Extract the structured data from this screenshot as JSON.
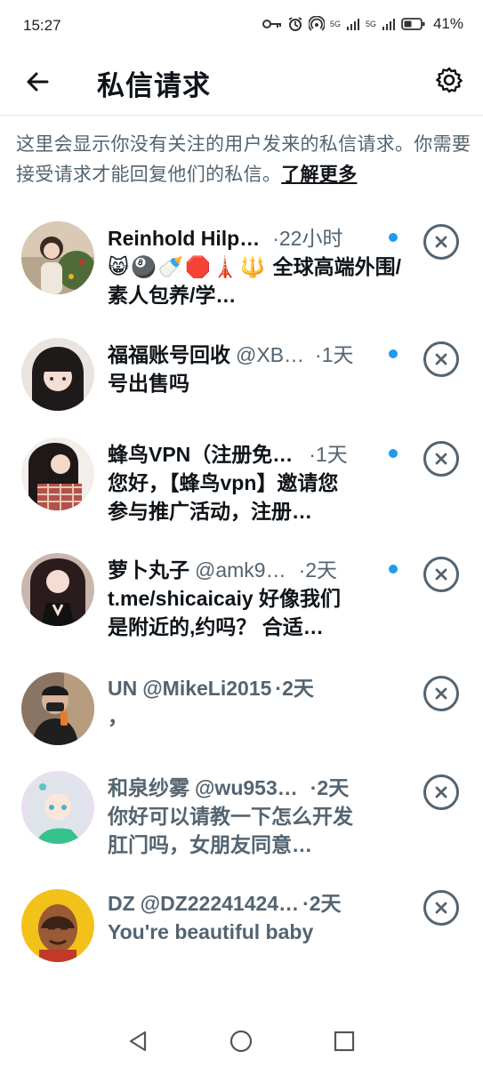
{
  "status_bar": {
    "time": "15:27",
    "net1": "1",
    "net1_type": "5G",
    "net2_type": "5G",
    "battery": "41%"
  },
  "header": {
    "title": "私信请求",
    "back_icon": "arrow-left-icon",
    "settings_icon": "gear-icon"
  },
  "notice": {
    "text": "这里会显示你没有关注的用户发来的私信请求。你需要接受请求才能回复他们的私信。",
    "learn_more": "了解更多"
  },
  "requests": [
    {
      "name": "Reinhold Hilp…",
      "handle": "",
      "sep": "·",
      "time": "22小时",
      "emoji": "😸🎱🍼🛑🗼🔱",
      "message": "全球高端外围/素人包养/学…",
      "unread": true
    },
    {
      "name": "福福账号回收",
      "handle": "@XB…",
      "sep": "·",
      "time": "1天",
      "message": "号出售吗",
      "unread": true
    },
    {
      "name": "蜂鸟VPN（注册免…",
      "handle": "",
      "sep": "·",
      "time": "1天",
      "message": "您好，【蜂鸟vpn】邀请您参与推广活动，注册…",
      "unread": true
    },
    {
      "name": "萝卜丸子",
      "handle": "@amk9…",
      "sep": "·",
      "time": "2天",
      "message": "t.me/shicaicaiy 好像我们是附近的,约吗？ 合适…",
      "unread": true
    },
    {
      "name": "UN",
      "handle": "@MikeLi2015",
      "sep": "·",
      "time": "2天",
      "message": "，",
      "unread": false
    },
    {
      "name": "和泉纱雾",
      "handle": "@wu953…",
      "sep": "·",
      "time": "2天",
      "message": "你好可以请教一下怎么开发肛门吗，女朋友同意…",
      "unread": false
    },
    {
      "name": "DZ",
      "handle": "@DZ22241424…",
      "sep": "·",
      "time": "2天",
      "message": "You're beautiful baby",
      "unread": false
    }
  ],
  "colors": {
    "accent": "#1d9bf0",
    "text": "#0f1419",
    "muted": "#536471"
  },
  "nav": {
    "back_icon": "triangle-back-icon",
    "home_icon": "circle-home-icon",
    "recents_icon": "square-recents-icon"
  }
}
